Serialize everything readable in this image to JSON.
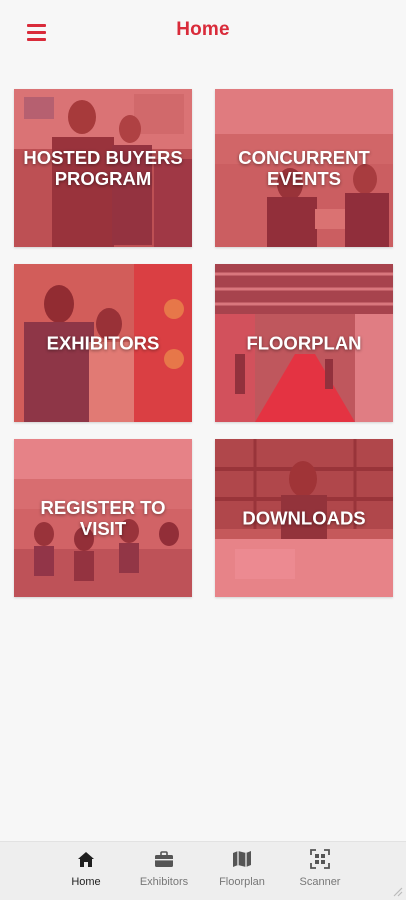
{
  "app": {
    "title": "Home"
  },
  "colors": {
    "accent": "#d92b3a",
    "overlay": "#e83a48"
  },
  "tiles": [
    {
      "label": "HOSTED BUYERS\nPROGRAM"
    },
    {
      "label": "CONCURRENT\nEVENTS"
    },
    {
      "label": "EXHIBITORS"
    },
    {
      "label": "FLOORPLAN"
    },
    {
      "label": "REGISTER TO\nVISIT"
    },
    {
      "label": "DOWNLOADS"
    }
  ],
  "bottom_nav": [
    {
      "label": "Home",
      "icon": "home-icon",
      "active": true
    },
    {
      "label": "Exhibitors",
      "icon": "briefcase-icon",
      "active": false
    },
    {
      "label": "Floorplan",
      "icon": "map-icon",
      "active": false
    },
    {
      "label": "Scanner",
      "icon": "qr-scanner-icon",
      "active": false
    }
  ]
}
